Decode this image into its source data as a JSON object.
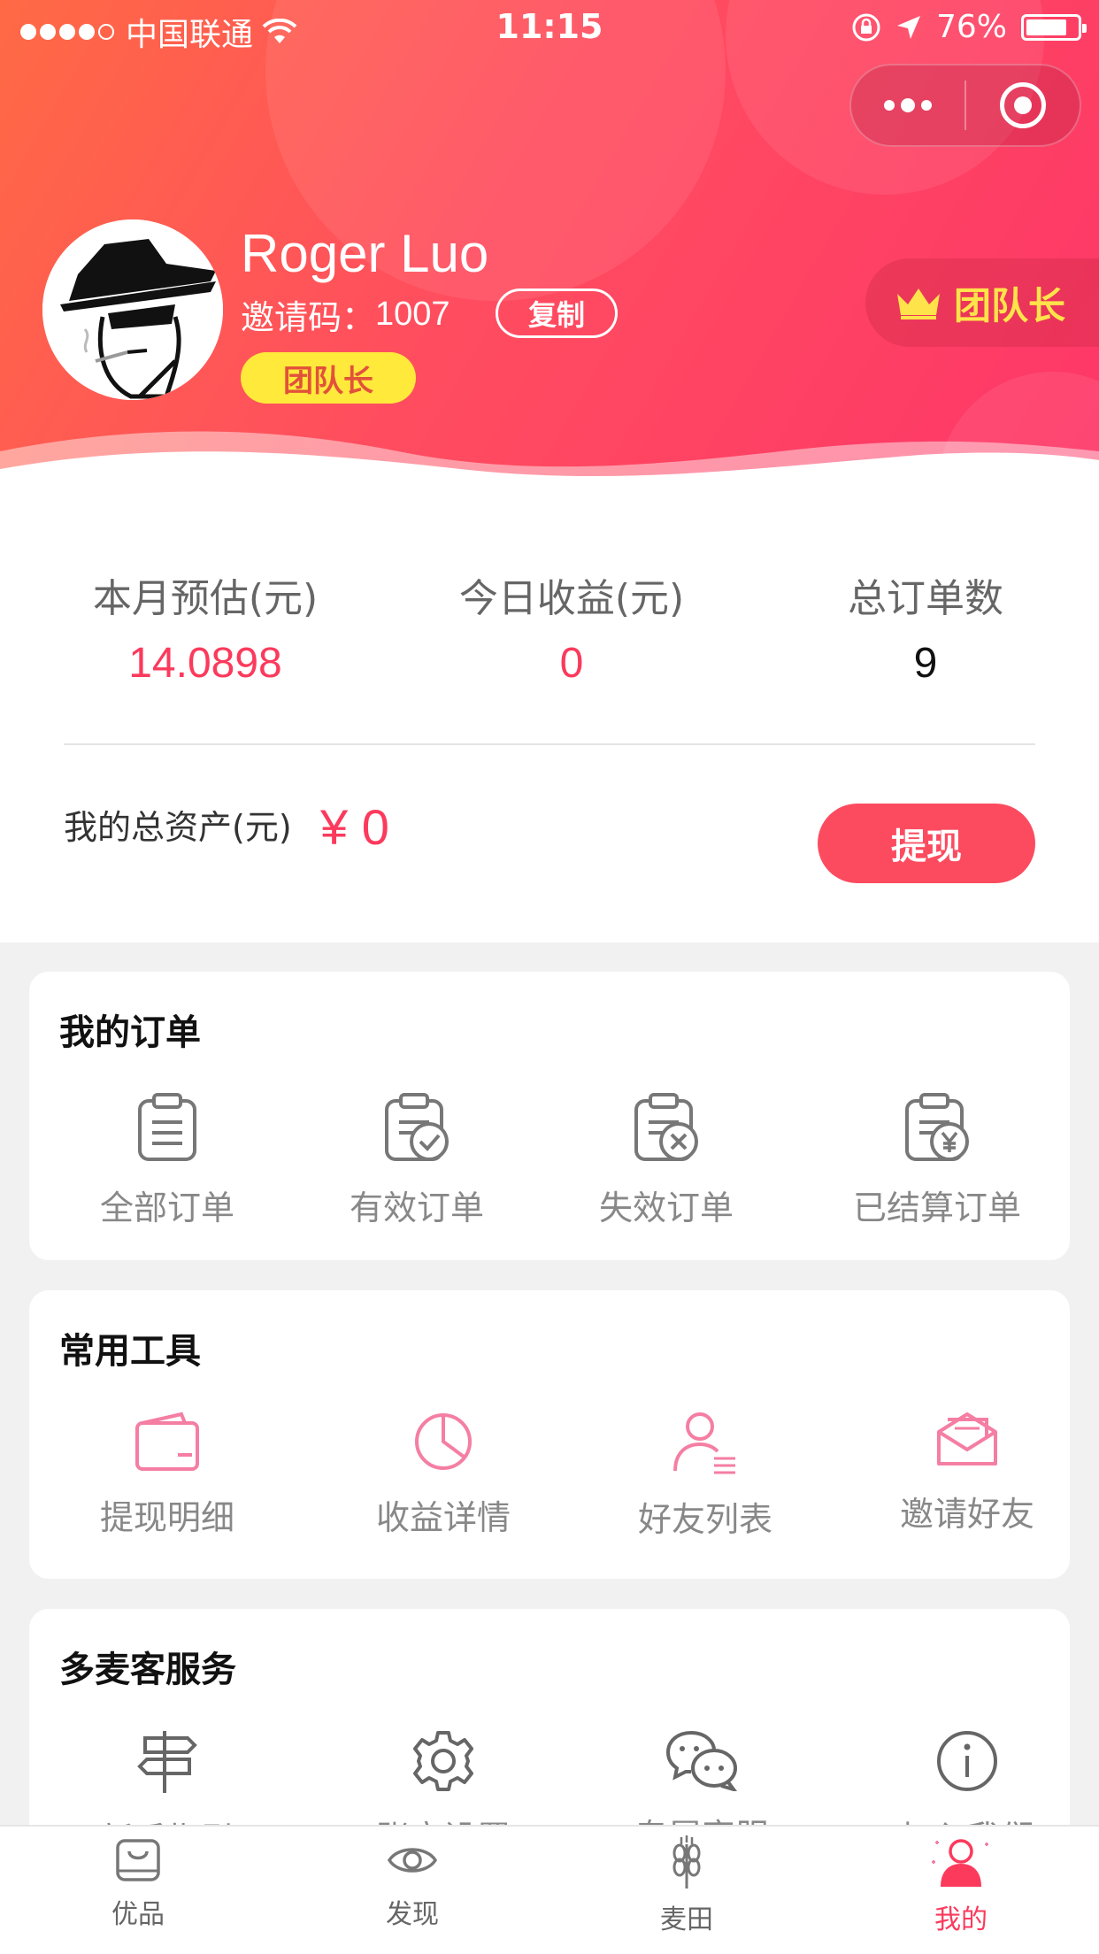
{
  "status_bar": {
    "carrier": "中国联通",
    "time": "11:15",
    "battery": "76%"
  },
  "profile": {
    "name": "Roger Luo",
    "invite_label": "邀请码：",
    "invite_code": "1007",
    "copy_label": "复制",
    "role_tag": "团队长",
    "leader_badge": "团队长"
  },
  "stats": [
    {
      "label": "本月预估(元)",
      "value": "14.0898",
      "color": "#fb3a5c"
    },
    {
      "label": "今日收益(元)",
      "value": "0",
      "color": "#fb3a5c"
    },
    {
      "label": "总订单数",
      "value": "9",
      "color": "#111111"
    }
  ],
  "assets": {
    "label": "我的总资产(元)",
    "value": "¥ 0",
    "withdraw_label": "提现"
  },
  "orders": {
    "title": "我的订单",
    "items": [
      {
        "label": "全部订单",
        "icon": "clipboard-list-icon"
      },
      {
        "label": "有效订单",
        "icon": "clipboard-check-icon"
      },
      {
        "label": "失效订单",
        "icon": "clipboard-x-icon"
      },
      {
        "label": "已结算订单",
        "icon": "clipboard-yen-icon"
      }
    ]
  },
  "tools": {
    "title": "常用工具",
    "items": [
      {
        "label": "提现明细",
        "icon": "wallet-icon"
      },
      {
        "label": "收益详情",
        "icon": "pie-chart-icon"
      },
      {
        "label": "好友列表",
        "icon": "user-list-icon"
      },
      {
        "label": "邀请好友",
        "icon": "envelope-icon"
      }
    ]
  },
  "services": {
    "title": "多麦客服务",
    "items": [
      {
        "label": "新手指引",
        "icon": "signpost-icon"
      },
      {
        "label": "账户设置",
        "icon": "gear-icon"
      },
      {
        "label": "专属客服",
        "icon": "chat-bubbles-icon"
      },
      {
        "label": "加入我们",
        "icon": "info-icon"
      }
    ]
  },
  "tabbar": [
    {
      "label": "优品",
      "icon": "shopping-bag-icon",
      "active": false
    },
    {
      "label": "发现",
      "icon": "eye-icon",
      "active": false
    },
    {
      "label": "麦田",
      "icon": "wheat-icon",
      "active": false
    },
    {
      "label": "我的",
      "icon": "user-icon",
      "active": true
    }
  ],
  "colors": {
    "accent": "#fb3a5c",
    "header_start": "#ff6a45",
    "header_end": "#fe3668",
    "tag_yellow": "#ffe93b",
    "icon_pink": "#f57ea3"
  }
}
